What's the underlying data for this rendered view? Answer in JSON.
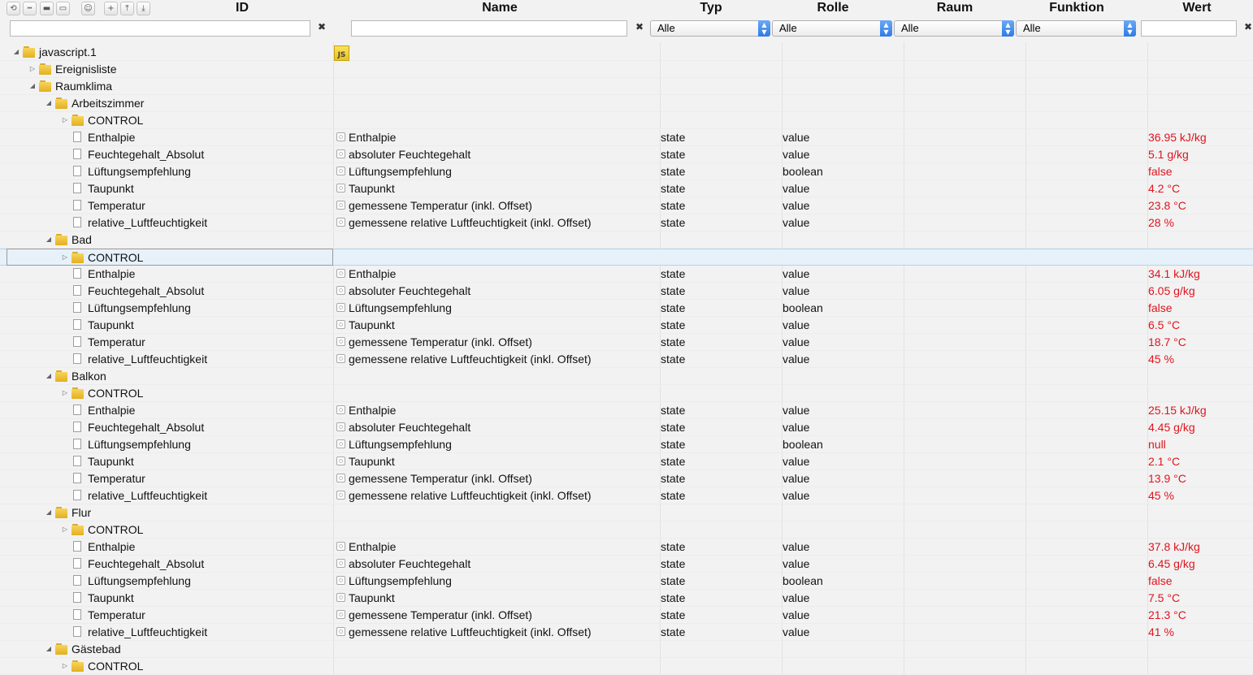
{
  "toolbar": {
    "buttons": [
      {
        "icon": "refresh-icon",
        "glyph": "⟲"
      },
      {
        "icon": "list-icon",
        "glyph": "┅"
      },
      {
        "icon": "folder-closed-icon",
        "glyph": "▬"
      },
      {
        "icon": "folder-open-icon",
        "glyph": "▭"
      },
      {
        "icon": "user-icon",
        "glyph": "☺"
      },
      {
        "icon": "add-icon",
        "glyph": "+"
      },
      {
        "icon": "upload-icon",
        "glyph": "⤒"
      },
      {
        "icon": "download-icon",
        "glyph": "⤓"
      }
    ]
  },
  "columns": {
    "id": "ID",
    "name": "Name",
    "typ": "Typ",
    "rolle": "Rolle",
    "raum": "Raum",
    "funktion": "Funktion",
    "wert": "Wert"
  },
  "filters": {
    "id_value": "",
    "name_value": "",
    "wert_value": "",
    "clear_glyph": "✖",
    "typ": "Alle",
    "rolle": "Alle",
    "raum": "Alle",
    "funktion": "Alle"
  },
  "rows": [
    {
      "id": "javascript.1",
      "kind": "folder",
      "level": 0,
      "expand": "open",
      "js": true
    },
    {
      "id": "Ereignisliste",
      "kind": "folder",
      "level": 1,
      "expand": "closed"
    },
    {
      "id": "Raumklima",
      "kind": "folder",
      "level": 1,
      "expand": "open"
    },
    {
      "id": "Arbeitszimmer",
      "kind": "folder",
      "level": 2,
      "expand": "open"
    },
    {
      "id": "CONTROL",
      "kind": "folder",
      "level": 3,
      "expand": "closed"
    },
    {
      "id": "Enthalpie",
      "kind": "state",
      "level": 3,
      "name": "Enthalpie",
      "typ": "state",
      "rolle": "value",
      "wert": "36.95 kJ/kg"
    },
    {
      "id": "Feuchtegehalt_Absolut",
      "kind": "state",
      "level": 3,
      "name": "absoluter Feuchtegehalt",
      "typ": "state",
      "rolle": "value",
      "wert": "5.1 g/kg"
    },
    {
      "id": "Lüftungsempfehlung",
      "kind": "state",
      "level": 3,
      "name": "Lüftungsempfehlung",
      "typ": "state",
      "rolle": "boolean",
      "wert": "false"
    },
    {
      "id": "Taupunkt",
      "kind": "state",
      "level": 3,
      "name": "Taupunkt",
      "typ": "state",
      "rolle": "value",
      "wert": "4.2 °C"
    },
    {
      "id": "Temperatur",
      "kind": "state",
      "level": 3,
      "name": "gemessene Temperatur (inkl. Offset)",
      "typ": "state",
      "rolle": "value",
      "wert": "23.8 °C"
    },
    {
      "id": "relative_Luftfeuchtigkeit",
      "kind": "state",
      "level": 3,
      "name": "gemessene relative Luftfeuchtigkeit (inkl. Offset)",
      "typ": "state",
      "rolle": "value",
      "wert": "28 %"
    },
    {
      "id": "Bad",
      "kind": "folder",
      "level": 2,
      "expand": "open"
    },
    {
      "id": "CONTROL",
      "kind": "folder",
      "level": 3,
      "expand": "closed",
      "selected": true
    },
    {
      "id": "Enthalpie",
      "kind": "state",
      "level": 3,
      "name": "Enthalpie",
      "typ": "state",
      "rolle": "value",
      "wert": "34.1 kJ/kg"
    },
    {
      "id": "Feuchtegehalt_Absolut",
      "kind": "state",
      "level": 3,
      "name": "absoluter Feuchtegehalt",
      "typ": "state",
      "rolle": "value",
      "wert": "6.05 g/kg"
    },
    {
      "id": "Lüftungsempfehlung",
      "kind": "state",
      "level": 3,
      "name": "Lüftungsempfehlung",
      "typ": "state",
      "rolle": "boolean",
      "wert": "false"
    },
    {
      "id": "Taupunkt",
      "kind": "state",
      "level": 3,
      "name": "Taupunkt",
      "typ": "state",
      "rolle": "value",
      "wert": "6.5 °C"
    },
    {
      "id": "Temperatur",
      "kind": "state",
      "level": 3,
      "name": "gemessene Temperatur (inkl. Offset)",
      "typ": "state",
      "rolle": "value",
      "wert": "18.7 °C"
    },
    {
      "id": "relative_Luftfeuchtigkeit",
      "kind": "state",
      "level": 3,
      "name": "gemessene relative Luftfeuchtigkeit (inkl. Offset)",
      "typ": "state",
      "rolle": "value",
      "wert": "45 %"
    },
    {
      "id": "Balkon",
      "kind": "folder",
      "level": 2,
      "expand": "open"
    },
    {
      "id": "CONTROL",
      "kind": "folder",
      "level": 3,
      "expand": "closed"
    },
    {
      "id": "Enthalpie",
      "kind": "state",
      "level": 3,
      "name": "Enthalpie",
      "typ": "state",
      "rolle": "value",
      "wert": "25.15 kJ/kg"
    },
    {
      "id": "Feuchtegehalt_Absolut",
      "kind": "state",
      "level": 3,
      "name": "absoluter Feuchtegehalt",
      "typ": "state",
      "rolle": "value",
      "wert": "4.45 g/kg"
    },
    {
      "id": "Lüftungsempfehlung",
      "kind": "state",
      "level": 3,
      "name": "Lüftungsempfehlung",
      "typ": "state",
      "rolle": "boolean",
      "wert": "null"
    },
    {
      "id": "Taupunkt",
      "kind": "state",
      "level": 3,
      "name": "Taupunkt",
      "typ": "state",
      "rolle": "value",
      "wert": "2.1 °C"
    },
    {
      "id": "Temperatur",
      "kind": "state",
      "level": 3,
      "name": "gemessene Temperatur (inkl. Offset)",
      "typ": "state",
      "rolle": "value",
      "wert": "13.9 °C"
    },
    {
      "id": "relative_Luftfeuchtigkeit",
      "kind": "state",
      "level": 3,
      "name": "gemessene relative Luftfeuchtigkeit (inkl. Offset)",
      "typ": "state",
      "rolle": "value",
      "wert": "45 %"
    },
    {
      "id": "Flur",
      "kind": "folder",
      "level": 2,
      "expand": "open"
    },
    {
      "id": "CONTROL",
      "kind": "folder",
      "level": 3,
      "expand": "closed"
    },
    {
      "id": "Enthalpie",
      "kind": "state",
      "level": 3,
      "name": "Enthalpie",
      "typ": "state",
      "rolle": "value",
      "wert": "37.8 kJ/kg"
    },
    {
      "id": "Feuchtegehalt_Absolut",
      "kind": "state",
      "level": 3,
      "name": "absoluter Feuchtegehalt",
      "typ": "state",
      "rolle": "value",
      "wert": "6.45 g/kg"
    },
    {
      "id": "Lüftungsempfehlung",
      "kind": "state",
      "level": 3,
      "name": "Lüftungsempfehlung",
      "typ": "state",
      "rolle": "boolean",
      "wert": "false"
    },
    {
      "id": "Taupunkt",
      "kind": "state",
      "level": 3,
      "name": "Taupunkt",
      "typ": "state",
      "rolle": "value",
      "wert": "7.5 °C"
    },
    {
      "id": "Temperatur",
      "kind": "state",
      "level": 3,
      "name": "gemessene Temperatur (inkl. Offset)",
      "typ": "state",
      "rolle": "value",
      "wert": "21.3 °C"
    },
    {
      "id": "relative_Luftfeuchtigkeit",
      "kind": "state",
      "level": 3,
      "name": "gemessene relative Luftfeuchtigkeit (inkl. Offset)",
      "typ": "state",
      "rolle": "value",
      "wert": "41 %"
    },
    {
      "id": "Gästebad",
      "kind": "folder",
      "level": 2,
      "expand": "open"
    },
    {
      "id": "CONTROL",
      "kind": "folder",
      "level": 3,
      "expand": "closed"
    }
  ],
  "colors": {
    "value_text": "#e0141e",
    "selection": "#e6f1fa",
    "select_arrow": "#2f7be6",
    "folder": "#f0c23a"
  }
}
